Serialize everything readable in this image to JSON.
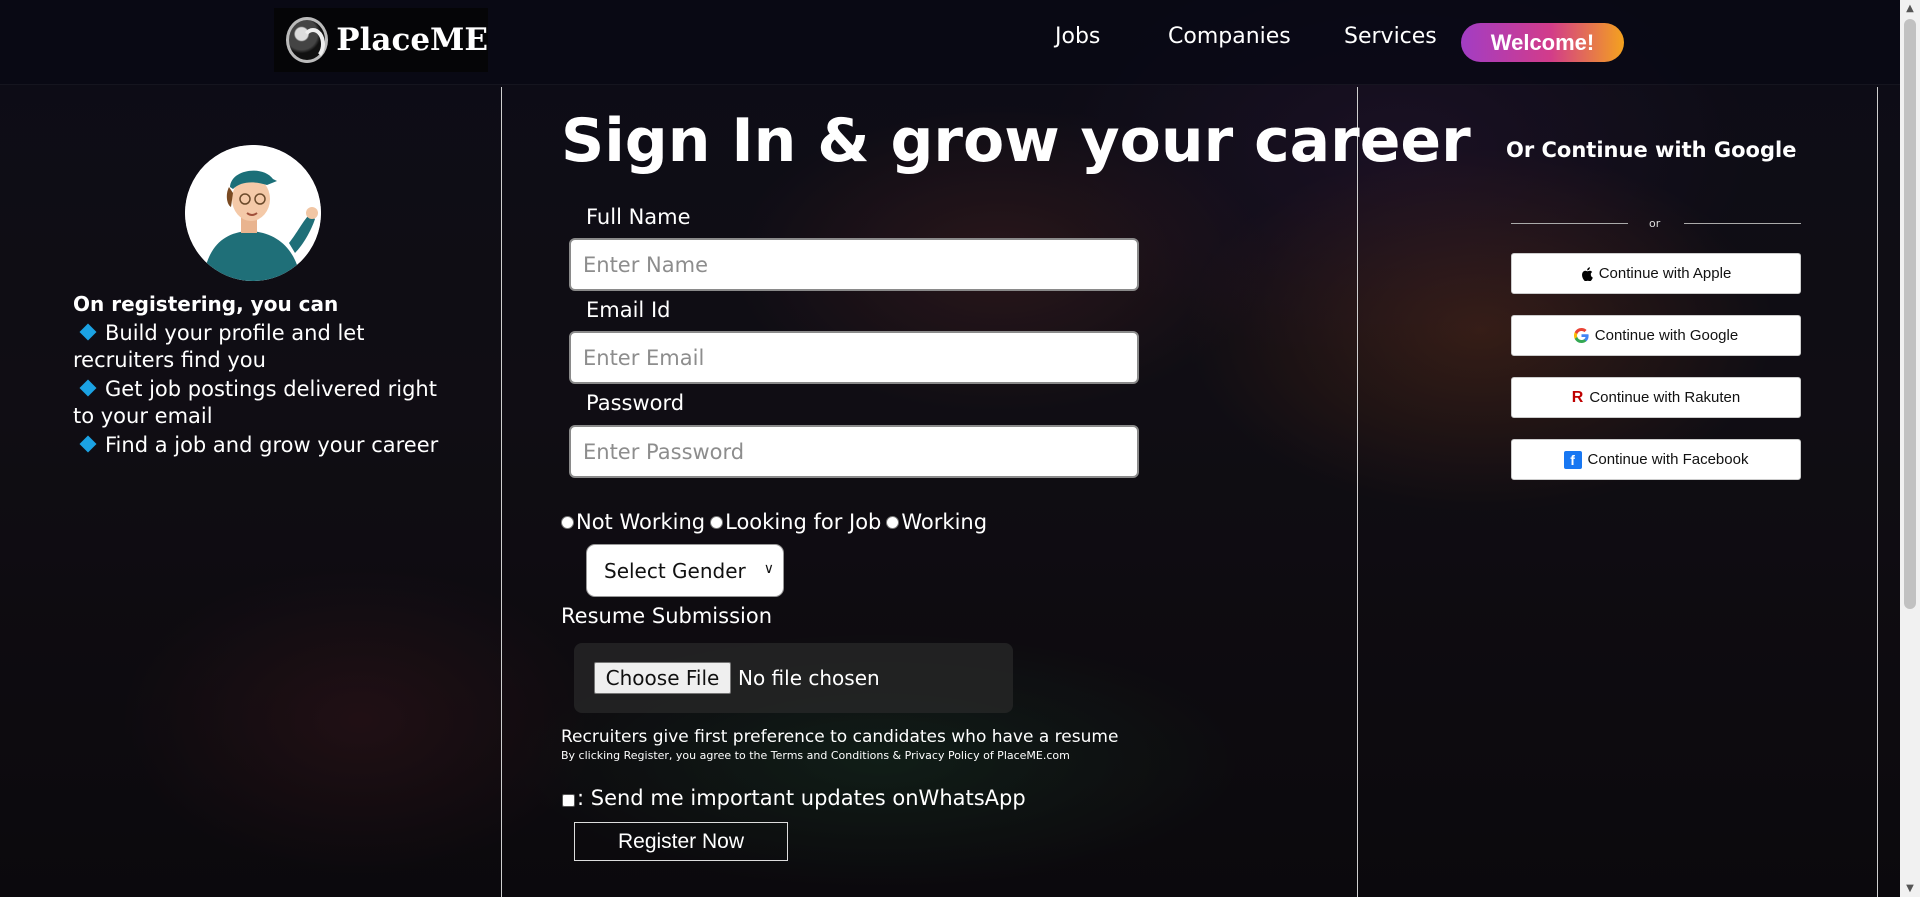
{
  "brand": {
    "name": "PlaceME"
  },
  "nav": {
    "jobs": "Jobs",
    "companies": "Companies",
    "services": "Services",
    "welcome": "Welcome!"
  },
  "left": {
    "title": "On registering, you can",
    "benefits": [
      "Build your profile and let recruiters find you",
      "Get job postings delivered right to your email",
      "Find a job and grow your career"
    ]
  },
  "form": {
    "headline": "Sign In & grow your career",
    "fullname_label": "Full Name",
    "fullname_placeholder": "Enter Name",
    "email_label": "Email Id",
    "email_placeholder": "Enter Email",
    "password_label": "Password",
    "password_placeholder": "Enter Password",
    "status_options": [
      "Not Working",
      "Looking for Job",
      "Working"
    ],
    "gender_select": "Select Gender",
    "resume_label": "Resume Submission",
    "file_button": "Choose File",
    "file_status": "No file chosen",
    "resume_note": "Recruiters give first preference to candidates who have a resume",
    "terms": "By clicking Register, you agree to the Terms and Conditions & Privacy Policy of PlaceME.com",
    "whatsapp": ": Send me important updates onWhatsApp",
    "register": "Register Now"
  },
  "social": {
    "title": "Or Continue with Google",
    "or": "or",
    "apple": "Continue with Apple",
    "google": "Continue with Google",
    "rakuten": "Continue with Rakuten",
    "facebook": "Continue with Facebook"
  },
  "colors": {
    "accent_blue": "#1ba2e3",
    "welcome_gradient": [
      "#a23dc4",
      "#d23c8a",
      "#f4a21e"
    ]
  }
}
